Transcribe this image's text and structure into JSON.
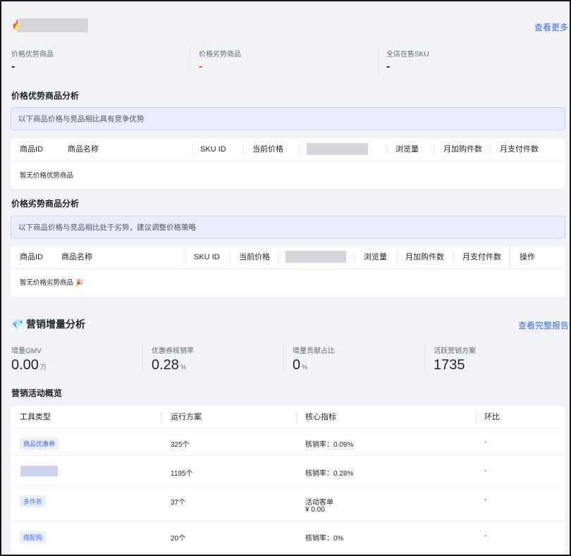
{
  "header": {
    "more_link": "查看更多"
  },
  "stats": [
    {
      "label": "价格优势商品",
      "value": "-"
    },
    {
      "label": "价格劣势商品",
      "value": "-",
      "accent": "#f5483b"
    },
    {
      "label": "全店在售SKU",
      "value": "-"
    }
  ],
  "advantage": {
    "title": "价格优势商品分析",
    "banner": "以下商品价格与竞品相比具有竞争优势",
    "columns": [
      "商品ID",
      "商品名称",
      "SKU ID",
      "当前价格",
      "浏览量",
      "月加购件数",
      "月支付件数"
    ],
    "empty": "暂无价格优势商品"
  },
  "disadvantage": {
    "title": "价格劣势商品分析",
    "banner": "以下商品价格与竞品相比处于劣势，建议调整价格策略",
    "columns": [
      "商品ID",
      "商品名称",
      "SKU ID",
      "当前价格",
      "浏览量",
      "月加购件数",
      "月支付件数",
      "操作"
    ],
    "empty": "暂无价格劣势商品 🎉"
  },
  "marketing": {
    "title": "营销增量分析",
    "report_link": "查看完整报告",
    "metrics": [
      {
        "label": "增量GMV",
        "value": "0.00",
        "unit": "万"
      },
      {
        "label": "优惠券核销率",
        "value": "0.28",
        "unit": "%"
      },
      {
        "label": "增量贡献占比",
        "value": "0",
        "unit": "%"
      },
      {
        "label": "活跃营销方案",
        "value": "1735",
        "unit": ""
      }
    ],
    "overview_title": "营销活动概览",
    "columns": [
      "工具类型",
      "运行方案",
      "核心指标",
      "环比"
    ],
    "rows": [
      {
        "tool": "商品优惠券",
        "plans": "325个",
        "metric": "核销率：0.09%",
        "metric2": "",
        "ratio": "-"
      },
      {
        "tool": "",
        "plans": "1195个",
        "metric": "核销率：0.28%",
        "metric2": "",
        "ratio": "-"
      },
      {
        "tool": "多件折",
        "plans": "37个",
        "metric": "活动客单",
        "metric2": "¥ 0.00",
        "ratio": "-"
      },
      {
        "tool": "搭配购",
        "plans": "20个",
        "metric": "核销率：0%",
        "metric2": "",
        "ratio": "-"
      }
    ]
  },
  "colors": {
    "accent": "#3b6ef5",
    "danger": "#f5483b",
    "background": "#f2f3f7"
  }
}
